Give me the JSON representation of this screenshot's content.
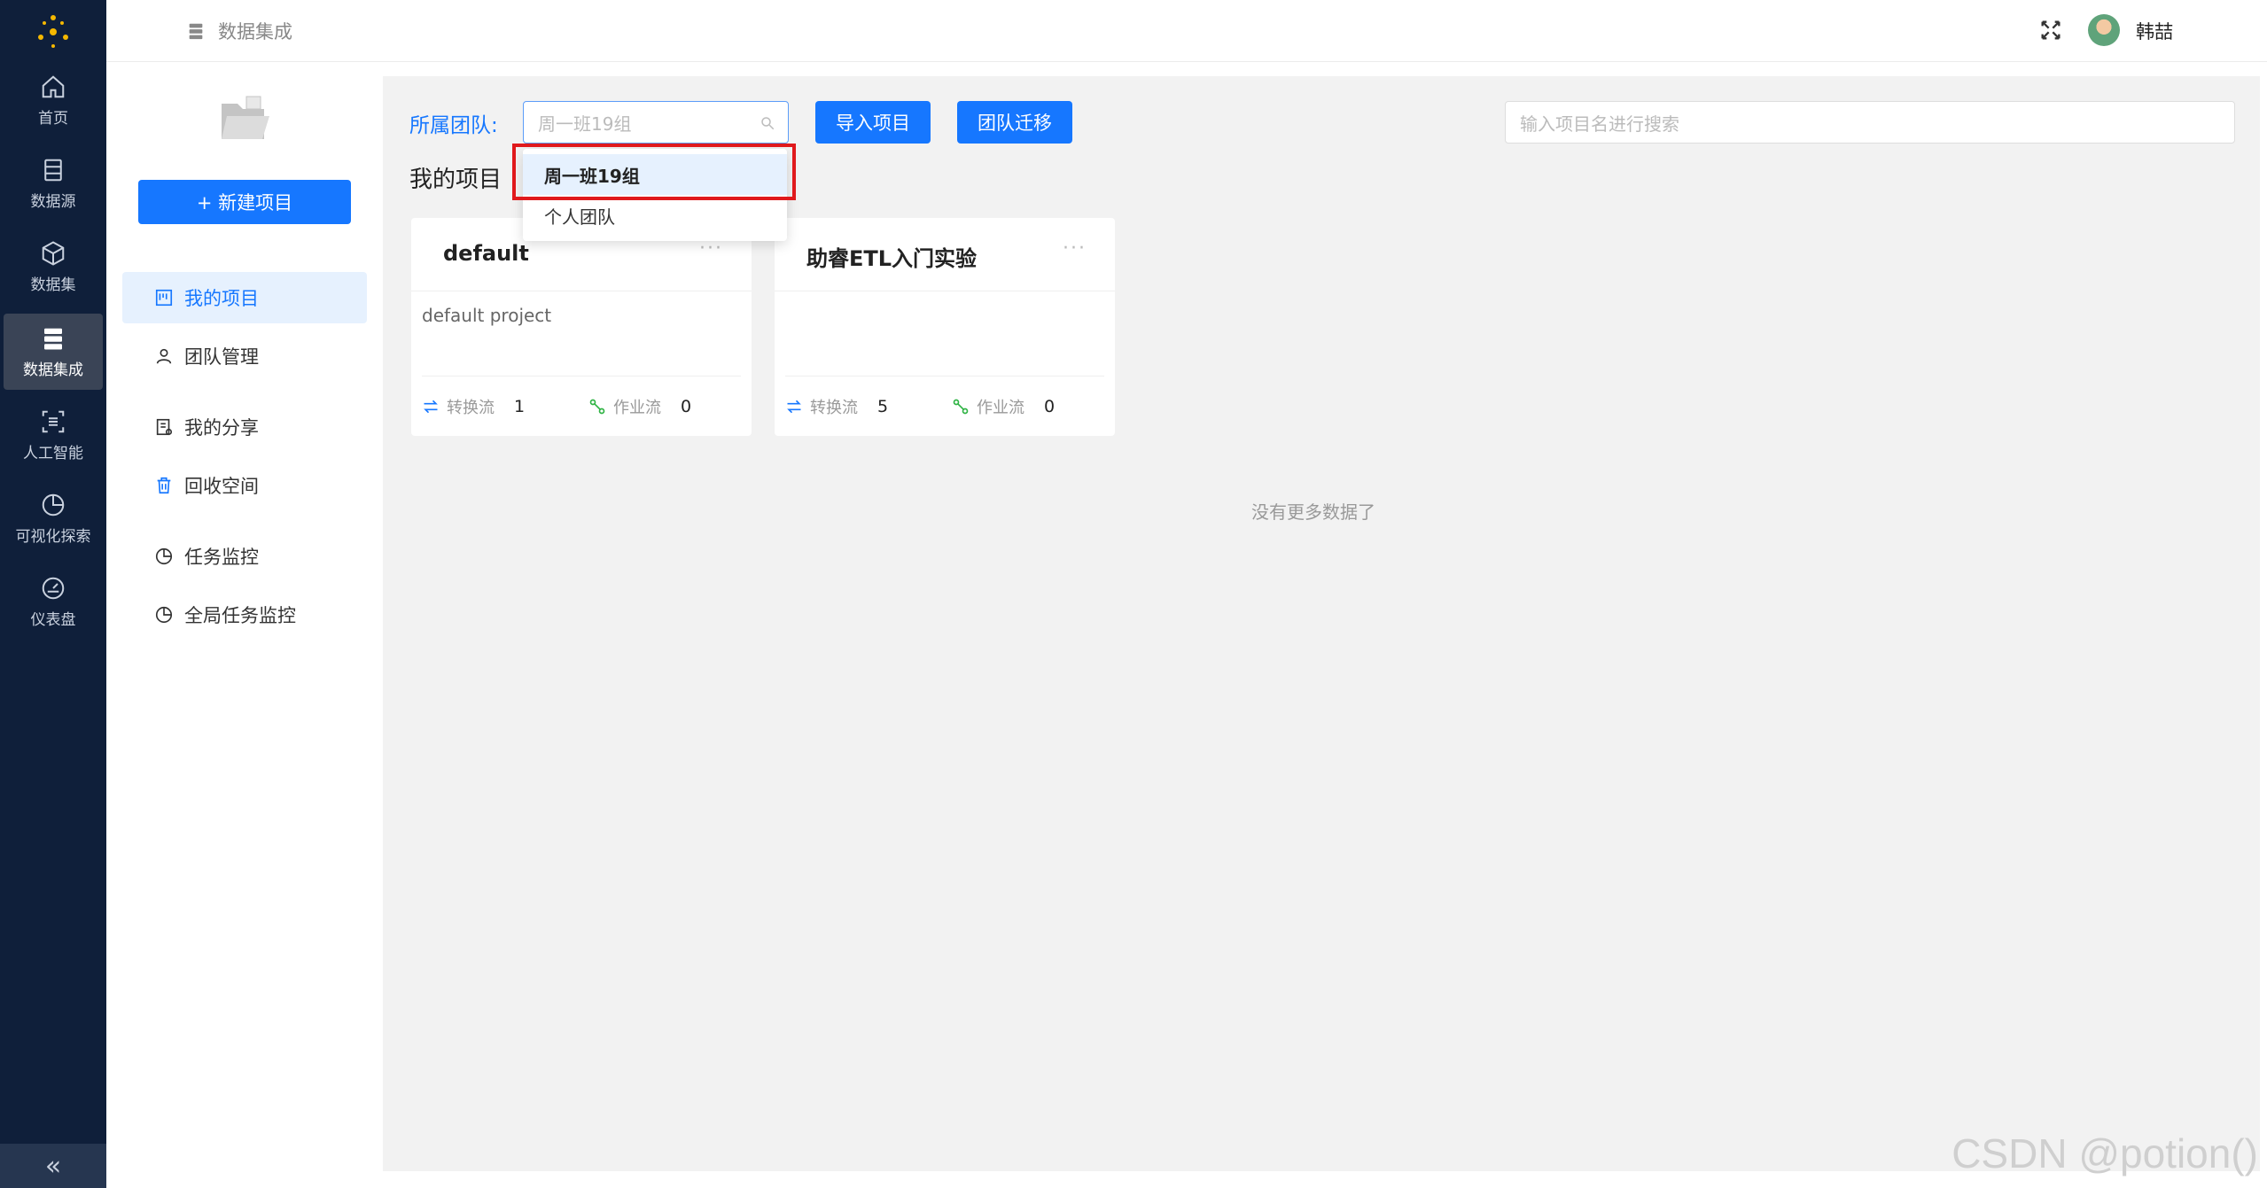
{
  "rail": {
    "items": [
      {
        "label": "首页",
        "icon": "home-icon"
      },
      {
        "label": "数据源",
        "icon": "database-icon"
      },
      {
        "label": "数据集",
        "icon": "cube-icon"
      },
      {
        "label": "数据集成",
        "icon": "server-icon",
        "active": true
      },
      {
        "label": "人工智能",
        "icon": "scan-icon"
      },
      {
        "label": "可视化探索",
        "icon": "pie-chart-icon"
      },
      {
        "label": "仪表盘",
        "icon": "dashboard-icon"
      }
    ],
    "collapse_label": "«"
  },
  "header": {
    "breadcrumb": "数据集成",
    "username": "韩喆"
  },
  "subside": {
    "new_button": "+ 新建项目",
    "items": [
      {
        "label": "我的项目",
        "icon": "project-icon",
        "active": true
      },
      {
        "label": "团队管理",
        "icon": "user-icon"
      },
      {
        "label": "我的分享",
        "icon": "share-icon"
      },
      {
        "label": "回收空间",
        "icon": "trash-icon"
      },
      {
        "label": "任务监控",
        "icon": "monitor-icon"
      },
      {
        "label": "全局任务监控",
        "icon": "monitor-icon"
      }
    ]
  },
  "main": {
    "team_label": "所属团队:",
    "team_select_value": "周一班19组",
    "import_button": "导入项目",
    "migrate_button": "团队迁移",
    "search_placeholder": "输入项目名进行搜索",
    "section_title": "我的项目",
    "dropdown_options": [
      "周一班19组",
      "个人团队"
    ],
    "cards": [
      {
        "title": "default",
        "description": "default project",
        "transform_label": "转换流",
        "transform_count": "1",
        "job_label": "作业流",
        "job_count": "0"
      },
      {
        "title": "助睿ETL入门实验",
        "description": "",
        "transform_label": "转换流",
        "transform_count": "5",
        "job_label": "作业流",
        "job_count": "0"
      }
    ],
    "more_menu": "···",
    "no_more": "没有更多数据了"
  },
  "watermark": "CSDN @potion()",
  "colors": {
    "rail_bg": "#0f1f3a",
    "primary": "#1677ff",
    "highlight_border": "#e0191c",
    "panel_bg": "#f2f2f2"
  }
}
